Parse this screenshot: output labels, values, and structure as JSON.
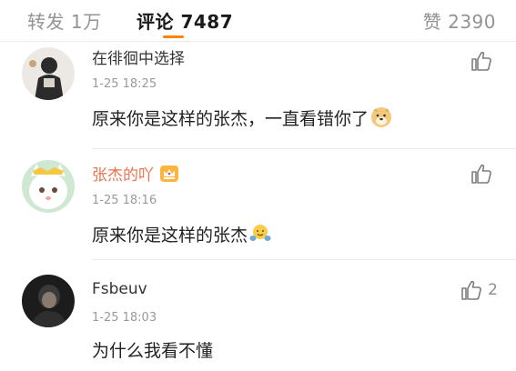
{
  "tabs": {
    "repost": "转发 1万",
    "comment": "评论 7487",
    "like": "赞 2390"
  },
  "comments": [
    {
      "username": "在徘徊中选择",
      "time": "1-25 18:25",
      "text": "原来你是这样的张杰，一直看错你了",
      "emoji": "doge-emoji",
      "likes": ""
    },
    {
      "username": "张杰的吖",
      "time": "1-25 18:16",
      "text": "原来你是这样的张杰",
      "emoji": "hug-emoji",
      "badge": "crown-badge-icon",
      "likes": ""
    },
    {
      "username": "Fsbeuv",
      "time": "1-25 18:03",
      "text": "为什么我看不懂",
      "likes": "2"
    }
  ],
  "colors": {
    "accent": "#ff8200",
    "username_highlight": "#eb7350"
  }
}
